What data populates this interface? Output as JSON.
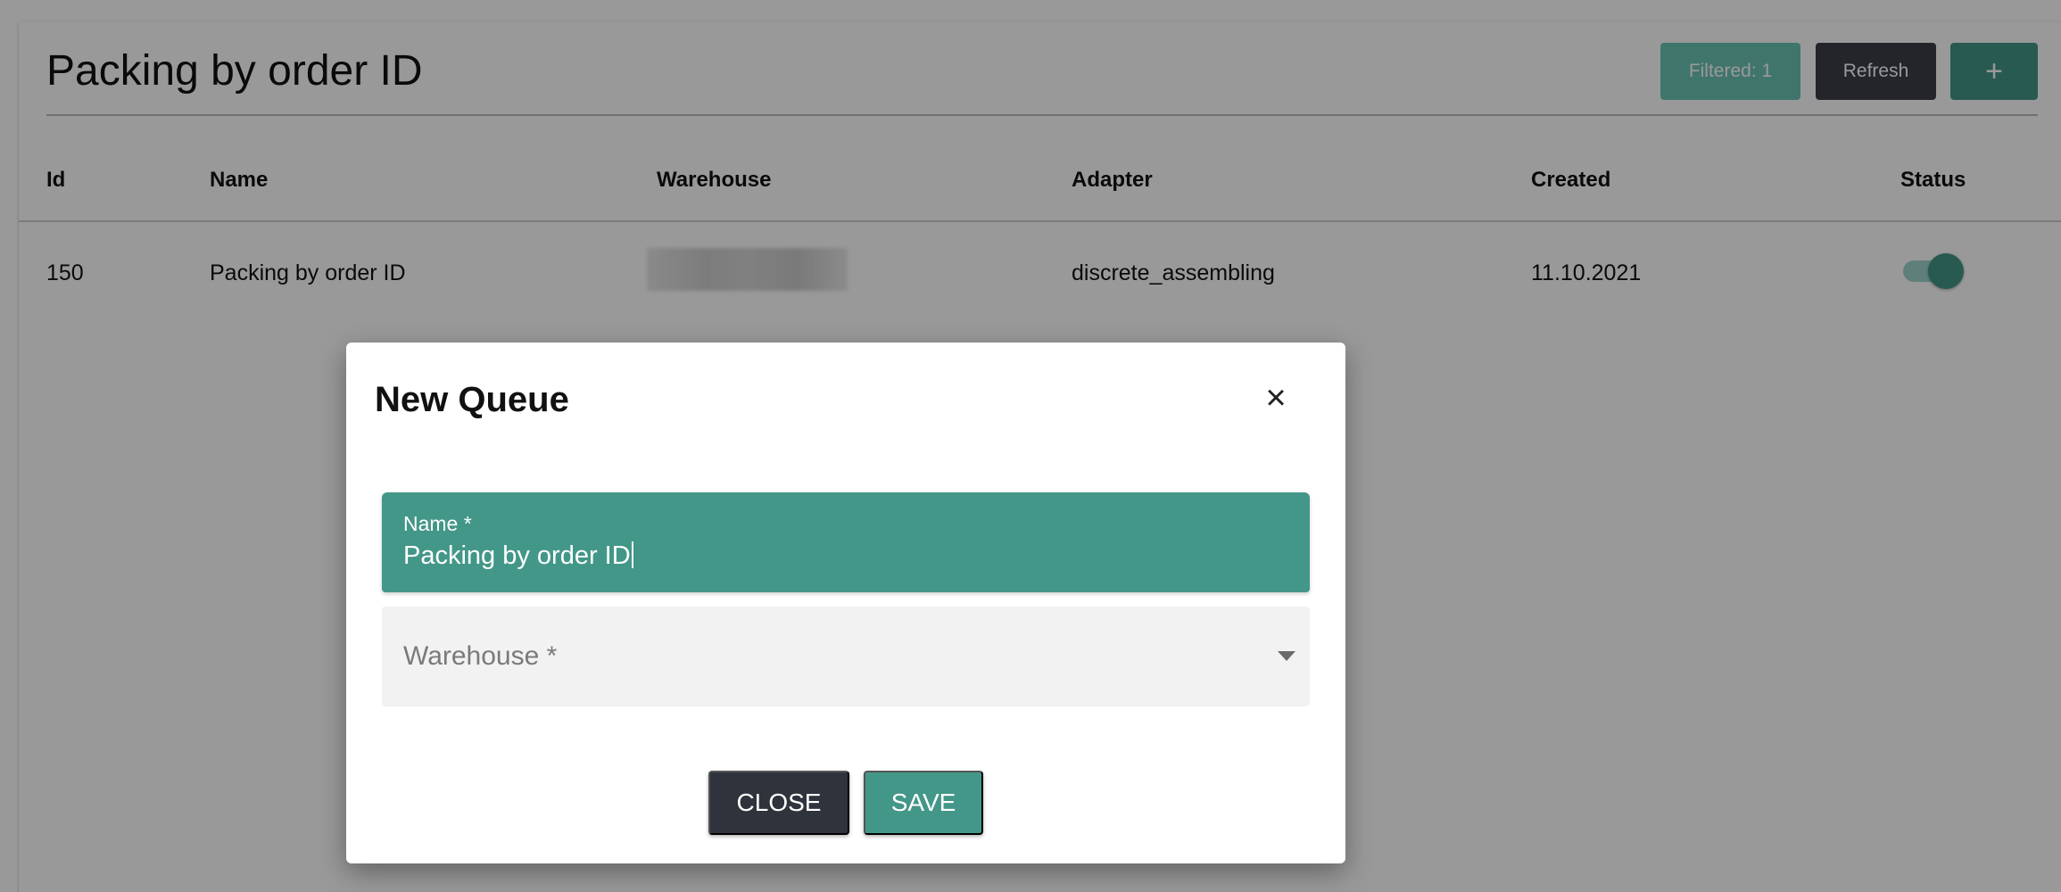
{
  "page": {
    "title": "Packing by order ID",
    "toolbar": {
      "filtered_label": "Filtered: 1",
      "refresh_label": "Refresh",
      "add_label": "+"
    }
  },
  "table": {
    "columns": [
      "Id",
      "Name",
      "Warehouse",
      "Adapter",
      "Created",
      "Status"
    ],
    "rows": [
      {
        "id": "150",
        "name": "Packing by order ID",
        "warehouse": "",
        "adapter": "discrete_assembling",
        "created": "11.10.2021",
        "status_on": true
      }
    ]
  },
  "dialog": {
    "title": "New Queue",
    "close_icon": "×",
    "name_field": {
      "label": "Name *",
      "value": "Packing by order ID"
    },
    "warehouse_field": {
      "placeholder": "Warehouse *"
    },
    "close_button": "Close",
    "save_button": "Save"
  },
  "colors": {
    "accent": "#439788",
    "dark_button": "#2f333b",
    "overlay": "rgba(0,0,0,0.40)"
  }
}
